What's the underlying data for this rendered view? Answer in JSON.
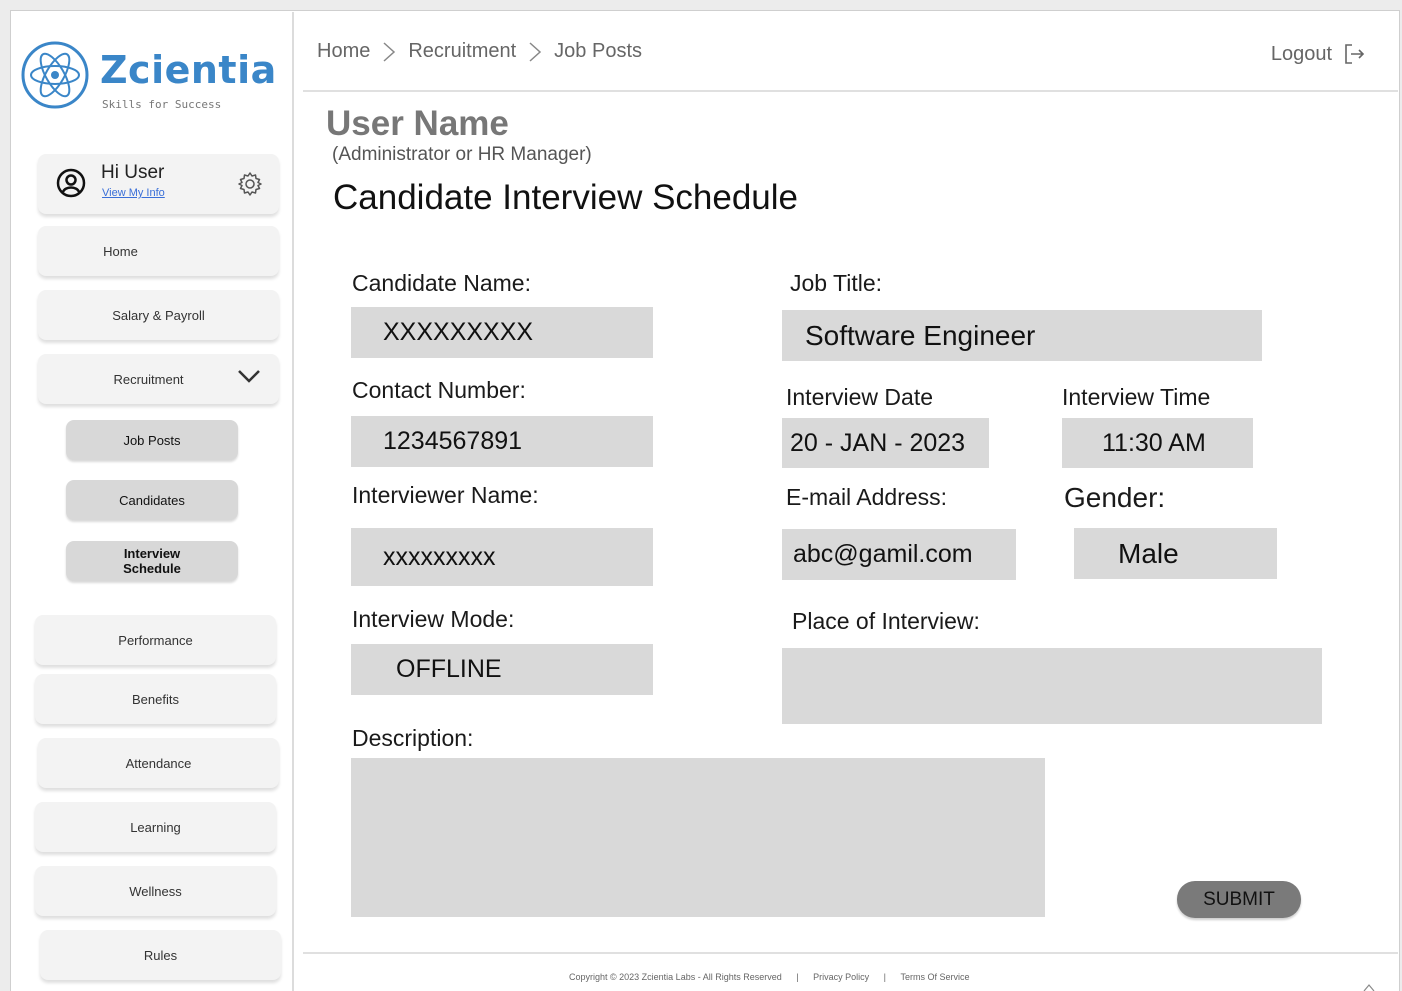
{
  "brand": {
    "name": "Zcientia",
    "tagline": "Skills for Success",
    "color": "#3a86c8"
  },
  "user_card": {
    "greeting": "Hi User",
    "link": "View My Info",
    "icon": "user-circle-icon",
    "settings_icon": "gear-icon"
  },
  "sidebar": {
    "items": [
      {
        "label": "Home"
      },
      {
        "label": "Salary &  Payroll"
      },
      {
        "label": "Recruitment",
        "expanded": true
      },
      {
        "label": "Performance"
      },
      {
        "label": "Benefits"
      },
      {
        "label": "Attendance"
      },
      {
        "label": "Learning"
      },
      {
        "label": "Wellness"
      },
      {
        "label": "Rules"
      }
    ],
    "recruitment_sub": [
      {
        "label": "Job Posts"
      },
      {
        "label": "Candidates"
      },
      {
        "label": "Interview Schedule"
      }
    ]
  },
  "header": {
    "breadcrumb": [
      "Home",
      "Recruitment",
      "Job Posts"
    ],
    "logout": "Logout"
  },
  "main": {
    "user_name": "User Name",
    "user_role": "(Administrator or HR Manager)",
    "title": "Candidate Interview Schedule"
  },
  "form": {
    "candidate_name": {
      "label": "Candidate Name:",
      "value": "XXXXXXXXX"
    },
    "job_title": {
      "label": "Job Title:",
      "value": "Software Engineer"
    },
    "contact_number": {
      "label": "Contact Number:",
      "value": "1234567891"
    },
    "interview_date": {
      "label": "Interview Date",
      "value": "20 - JAN - 2023"
    },
    "interview_time": {
      "label": "Interview Time",
      "value": "11:30 AM"
    },
    "interviewer_name": {
      "label": "Interviewer Name:",
      "value": "xxxxxxxxx"
    },
    "email": {
      "label": "E-mail Address:",
      "value": "abc@gamil.com"
    },
    "gender": {
      "label": "Gender:",
      "value": "Male"
    },
    "interview_mode": {
      "label": "Interview Mode:",
      "value": "OFFLINE"
    },
    "place": {
      "label": "Place of Interview:",
      "value": ""
    },
    "description": {
      "label": "Description:",
      "value": ""
    },
    "submit": "SUBMIT"
  },
  "footer": {
    "copyright": "Copyright © 2023 Zcientia Labs - All Rights Reserved",
    "sep": "|",
    "privacy": "Privacy Policy",
    "terms": "Terms Of Service"
  }
}
